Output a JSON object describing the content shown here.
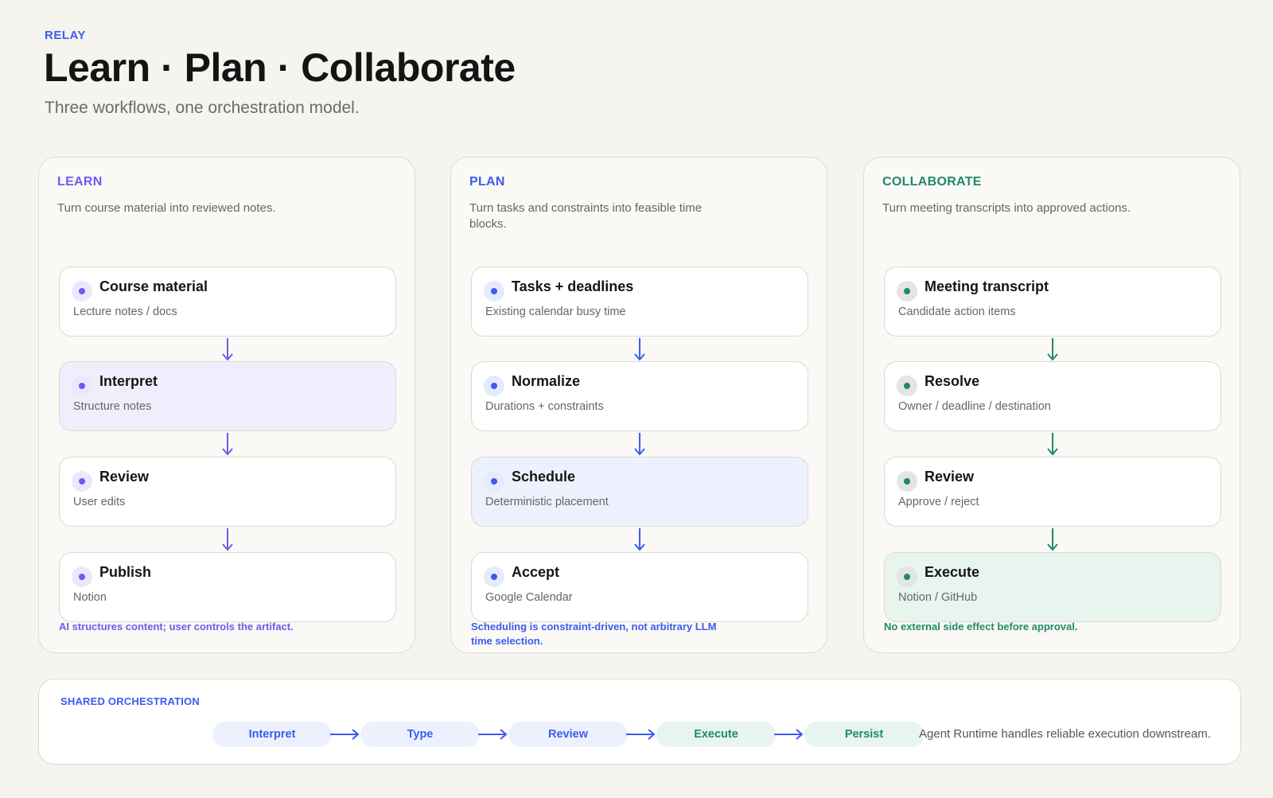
{
  "header": {
    "eyebrow": "RELAY",
    "title": "Learn · Plan · Collaborate",
    "subtitle": "Three workflows, one orchestration model."
  },
  "colors": {
    "learn": "#6a5cf0",
    "plan": "#3b5cf0",
    "collaborate": "#1f8a6a",
    "learn_highlight": "#f0eefc",
    "plan_highlight": "#edf1fd",
    "collaborate_highlight": "#e8f4ee"
  },
  "panels": [
    {
      "label": "LEARN",
      "description": "Turn course material into reviewed notes.",
      "steps": [
        {
          "title": "Course material",
          "subtitle": "Lecture notes / docs"
        },
        {
          "title": "Interpret",
          "subtitle": "Structure notes"
        },
        {
          "title": "Review",
          "subtitle": "User edits"
        },
        {
          "title": "Publish",
          "subtitle": "Notion"
        }
      ],
      "highlight_step": 1,
      "note": "AI structures content; user controls the artifact."
    },
    {
      "label": "PLAN",
      "description": "Turn tasks and constraints into feasible time blocks.",
      "steps": [
        {
          "title": "Tasks + deadlines",
          "subtitle": "Existing calendar busy time"
        },
        {
          "title": "Normalize",
          "subtitle": "Durations + constraints"
        },
        {
          "title": "Schedule",
          "subtitle": "Deterministic placement"
        },
        {
          "title": "Accept",
          "subtitle": "Google Calendar"
        }
      ],
      "highlight_step": 2,
      "note": "Scheduling is constraint-driven, not arbitrary LLM time selection."
    },
    {
      "label": "COLLABORATE",
      "description": "Turn meeting transcripts into approved actions.",
      "steps": [
        {
          "title": "Meeting transcript",
          "subtitle": "Candidate action items"
        },
        {
          "title": "Resolve",
          "subtitle": "Owner / deadline / destination"
        },
        {
          "title": "Review",
          "subtitle": "Approve / reject"
        },
        {
          "title": "Execute",
          "subtitle": "Notion / GitHub"
        }
      ],
      "highlight_step": 3,
      "note": "No external side effect before approval."
    }
  ],
  "shared": {
    "label": "SHARED ORCHESTRATION",
    "pipeline": [
      {
        "label": "Interpret",
        "tone": "plan"
      },
      {
        "label": "Type",
        "tone": "plan"
      },
      {
        "label": "Review",
        "tone": "plan"
      },
      {
        "label": "Execute",
        "tone": "collaborate"
      },
      {
        "label": "Persist",
        "tone": "collaborate"
      }
    ],
    "note": "Agent Runtime handles reliable execution downstream."
  }
}
